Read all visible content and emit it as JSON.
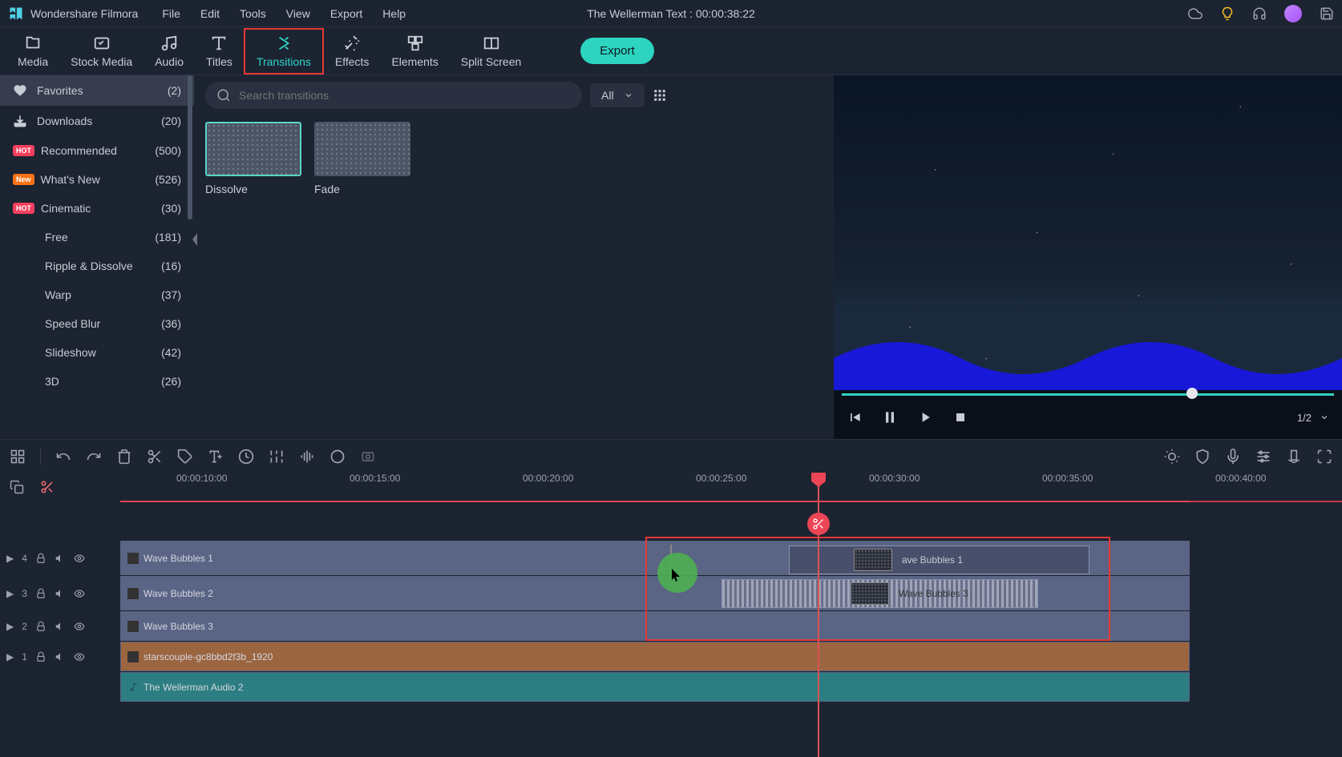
{
  "app": {
    "name": "Wondershare Filmora",
    "project_title": "The Wellerman Text : 00:00:38:22"
  },
  "menubar": {
    "file": "File",
    "edit": "Edit",
    "tools": "Tools",
    "view": "View",
    "export": "Export",
    "help": "Help"
  },
  "tool_tabs": {
    "media": "Media",
    "stock_media": "Stock Media",
    "audio": "Audio",
    "titles": "Titles",
    "transitions": "Transitions",
    "effects": "Effects",
    "elements": "Elements",
    "split_screen": "Split Screen",
    "export_btn": "Export"
  },
  "sidebar": {
    "items": [
      {
        "label": "Favorites",
        "count": "(2)",
        "icon": "heart",
        "active": true
      },
      {
        "label": "Downloads",
        "count": "(20)",
        "icon": "download"
      },
      {
        "label": "Recommended",
        "count": "(500)",
        "badge": "HOT",
        "badge_class": "hot"
      },
      {
        "label": "What's New",
        "count": "(526)",
        "badge": "New",
        "badge_class": "new"
      },
      {
        "label": "Cinematic",
        "count": "(30)",
        "badge": "HOT",
        "badge_class": "hot"
      },
      {
        "label": "Free",
        "count": "(181)",
        "sub": true
      },
      {
        "label": "Ripple & Dissolve",
        "count": "(16)",
        "sub": true
      },
      {
        "label": "Warp",
        "count": "(37)",
        "sub": true
      },
      {
        "label": "Speed Blur",
        "count": "(36)",
        "sub": true
      },
      {
        "label": "Slideshow",
        "count": "(42)",
        "sub": true
      },
      {
        "label": "3D",
        "count": "(26)",
        "sub": true
      }
    ]
  },
  "search": {
    "placeholder": "Search transitions",
    "filter": "All"
  },
  "transitions": {
    "dissolve": "Dissolve",
    "fade": "Fade"
  },
  "preview": {
    "zoom": "1/2"
  },
  "ruler": {
    "ticks": [
      {
        "label": "00:00:10:00",
        "pos": 70
      },
      {
        "label": "00:00:15:00",
        "pos": 286
      },
      {
        "label": "00:00:20:00",
        "pos": 502
      },
      {
        "label": "00:00:25:00",
        "pos": 718
      },
      {
        "label": "00:00:30:00",
        "pos": 934
      },
      {
        "label": "00:00:35:00",
        "pos": 1150
      },
      {
        "label": "00:00:40:00",
        "pos": 1366
      }
    ]
  },
  "tracks": {
    "t4_num": "4",
    "t3_num": "3",
    "t2_num": "2",
    "t1_num": "1",
    "clip1": "Wave Bubbles 1",
    "clip2": "Wave Bubbles 2",
    "clip3": "Wave Bubbles 3",
    "clip_image": "starscouple-gc8bbd2f3b_1920",
    "clip_audio": "The Wellerman Audio 2",
    "trans_clip1": "ave Bubbles 1",
    "trans_clip2": "Wave Bubbles 3"
  }
}
